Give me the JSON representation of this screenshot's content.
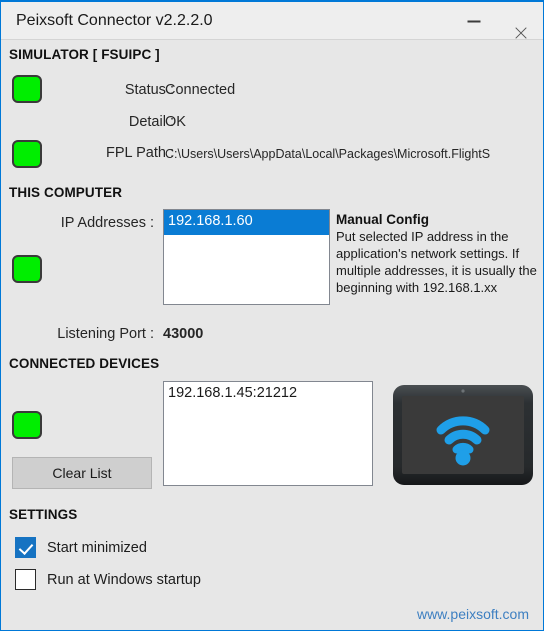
{
  "window": {
    "title": "Peixsoft Connector v2.2.2.0",
    "minimize_label": "Minimize",
    "close_label": "Close",
    "accent_color": "#0078d7",
    "background_color": "#e7e7e7"
  },
  "simulator": {
    "header": "SIMULATOR  [ FSUIPC ]",
    "status_label": "Status :",
    "status_value": "Connected",
    "detail_label": "Detail :",
    "detail_value": "OK",
    "fpl_path_label": "FPL Path :",
    "fpl_path_value": "C:\\Users\\Users\\AppData\\Local\\Packages\\Microsoft.FlightS",
    "led_status_color": "#00ee00",
    "led_fpl_color": "#00ee00"
  },
  "this_computer": {
    "header": "THIS COMPUTER",
    "ip_addresses_label": "IP Addresses :",
    "ip_addresses": [
      "192.168.1.60"
    ],
    "selected_ip": "192.168.1.60",
    "selection_color": "#0a7cd4",
    "led_color": "#00ee00",
    "listening_port_label": "Listening Port :",
    "listening_port_value": "43000",
    "manual_config": {
      "title": "Manual Config",
      "text": "Put selected IP address in the application's network settings. If multiple addresses, it is usually the beginning with 192.168.1.xx"
    }
  },
  "connected_devices": {
    "header": "CONNECTED DEVICES",
    "devices": [
      "192.168.1.45:21212"
    ],
    "led_color": "#00ee00",
    "clear_list_label": "Clear List",
    "device_icon": "tablet-wifi-icon",
    "device_icon_color": "#1f9fe8"
  },
  "settings": {
    "header": "SETTINGS",
    "options": [
      {
        "label": "Start minimized",
        "checked": true
      },
      {
        "label": "Run at Windows startup",
        "checked": false
      }
    ]
  },
  "footer": {
    "link_text": "www.peixsoft.com",
    "link_color": "#3d7fc1"
  }
}
